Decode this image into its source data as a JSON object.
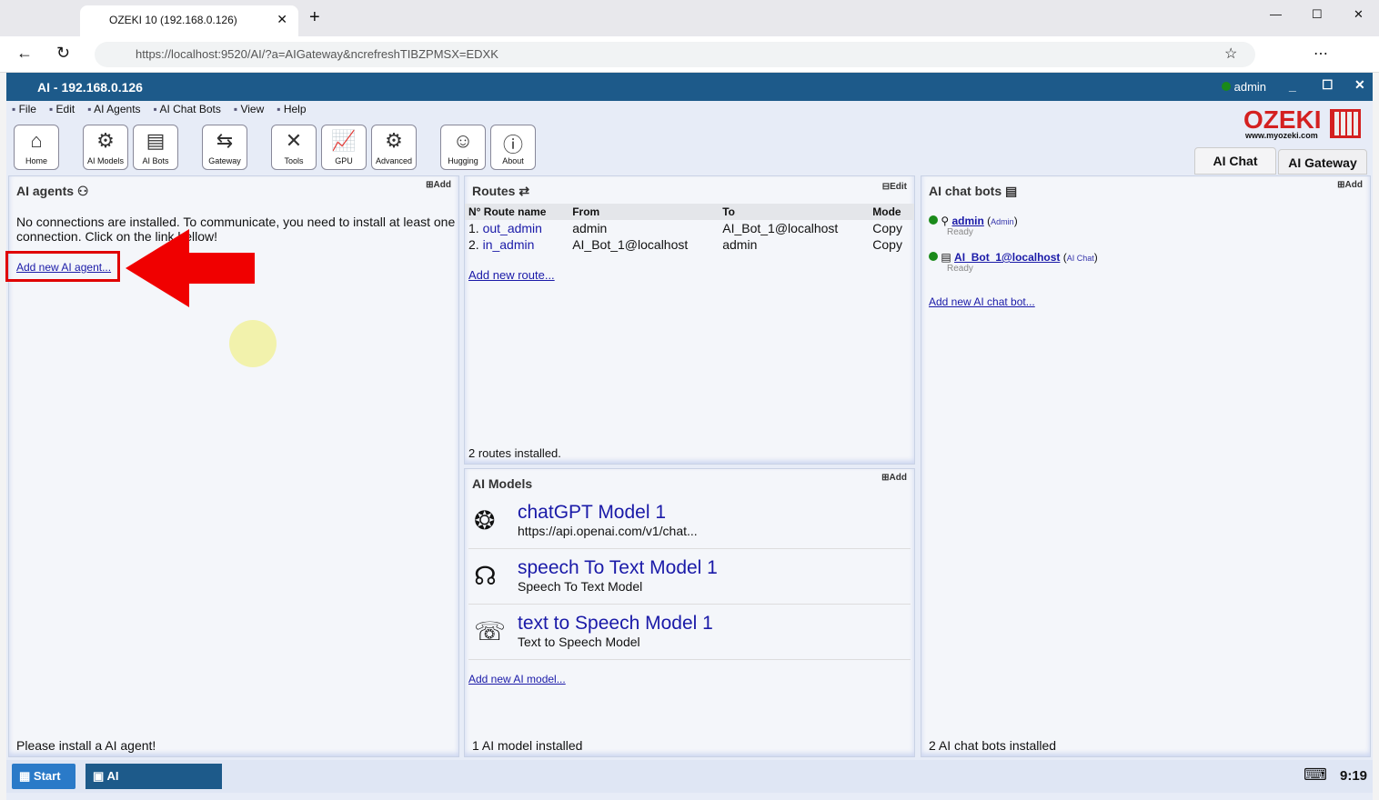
{
  "browser": {
    "tab_title": "OZEKI 10 (192.168.0.126)",
    "url": "https://localhost:9520/AI/?a=AIGateway&ncrefreshTIBZPMSX=EDXK"
  },
  "app": {
    "title": "AI - 192.168.0.126",
    "user": "admin",
    "logo": "OZEKI",
    "logo_url": "www.myozeki.com"
  },
  "menu": [
    "File",
    "Edit",
    "AI Agents",
    "AI Chat Bots",
    "View",
    "Help"
  ],
  "toolbar": [
    {
      "label": "Home",
      "icon": "home-icon"
    },
    {
      "label": "AI Models",
      "icon": "gear-brain-icon"
    },
    {
      "label": "AI Bots",
      "icon": "bot-icon"
    },
    {
      "label": "Gateway",
      "icon": "gateway-icon"
    },
    {
      "label": "Tools",
      "icon": "tools-icon"
    },
    {
      "label": "GPU",
      "icon": "gpu-icon"
    },
    {
      "label": "Advanced",
      "icon": "gear-icon"
    },
    {
      "label": "Hugging",
      "icon": "hugging-icon"
    },
    {
      "label": "About",
      "icon": "info-icon"
    }
  ],
  "tabs": [
    "AI Chat",
    "AI Gateway"
  ],
  "agents": {
    "title": "AI agents",
    "add": "Add",
    "message": "No connections are installed. To communicate, you need to install at least one connection. Click on the link bellow!",
    "link": "Add new AI agent...",
    "footer": "Please install a AI agent!"
  },
  "routes": {
    "title": "Routes",
    "edit": "Edit",
    "headers": [
      "N° Route name",
      "From",
      "To",
      "Mode"
    ],
    "rows": [
      {
        "n": "1.",
        "name": "out_admin",
        "from": "admin",
        "to": "AI_Bot_1@localhost",
        "mode": "Copy"
      },
      {
        "n": "2.",
        "name": "in_admin",
        "from": "AI_Bot_1@localhost",
        "to": "admin",
        "mode": "Copy"
      }
    ],
    "link": "Add new route...",
    "footer": "2 routes installed."
  },
  "models": {
    "title": "AI Models",
    "add": "Add",
    "items": [
      {
        "name": "chatGPT Model 1",
        "sub": "https://api.openai.com/v1/chat..."
      },
      {
        "name": "speech To Text Model 1",
        "sub": "Speech To Text Model"
      },
      {
        "name": "text to Speech Model 1",
        "sub": "Text to Speech Model"
      }
    ],
    "link": "Add new AI model...",
    "footer": "1 AI model installed"
  },
  "bots": {
    "title": "AI chat bots",
    "add": "Add",
    "items": [
      {
        "name": "admin",
        "type": "Admin",
        "status": "Ready"
      },
      {
        "name": "AI_Bot_1@localhost",
        "type": "AI Chat",
        "status": "Ready"
      }
    ],
    "link": "Add new AI chat bot...",
    "footer": "2 AI chat bots installed"
  },
  "taskbar": {
    "start": "Start",
    "app": "AI",
    "time": "9:19"
  }
}
